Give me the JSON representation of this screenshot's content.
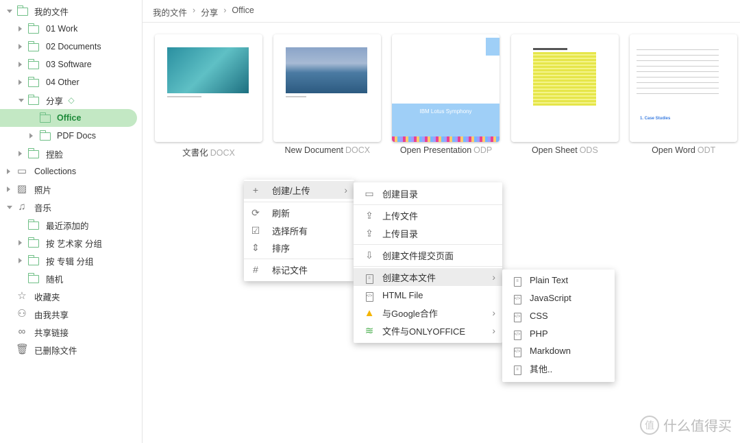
{
  "sidebar": {
    "items": [
      {
        "label": "我的文件",
        "level": 0,
        "expander": "expanded",
        "icon": "folder-icon"
      },
      {
        "label": "01 Work",
        "level": 1,
        "expander": "collapsed",
        "icon": "folder-icon"
      },
      {
        "label": "02 Documents",
        "level": 1,
        "expander": "collapsed",
        "icon": "folder-icon"
      },
      {
        "label": "03 Software",
        "level": 1,
        "expander": "collapsed",
        "icon": "folder-icon"
      },
      {
        "label": "04 Other",
        "level": 1,
        "expander": "collapsed",
        "icon": "folder-icon"
      },
      {
        "label": "分享",
        "level": 1,
        "expander": "expanded",
        "icon": "folder-icon",
        "tag": "tag-icon"
      },
      {
        "label": "Office",
        "level": 2,
        "expander": "none",
        "icon": "folder-icon",
        "active": true
      },
      {
        "label": "PDF Docs",
        "level": 2,
        "expander": "collapsed",
        "icon": "folder-icon"
      },
      {
        "label": "捏脸",
        "level": 1,
        "expander": "collapsed",
        "icon": "folder-icon"
      },
      {
        "label": "Collections",
        "level": 0,
        "expander": "collapsed",
        "icon": "archive-icon"
      },
      {
        "label": "照片",
        "level": 0,
        "expander": "collapsed",
        "icon": "image-icon"
      },
      {
        "label": "音乐",
        "level": 0,
        "expander": "expanded",
        "icon": "music-icon"
      },
      {
        "label": "最近添加的",
        "level": 1,
        "expander": "none",
        "icon": "folder-icon"
      },
      {
        "label": "按 艺术家 分组",
        "level": 1,
        "expander": "collapsed",
        "icon": "folder-icon"
      },
      {
        "label": "按 专辑 分组",
        "level": 1,
        "expander": "collapsed",
        "icon": "folder-icon"
      },
      {
        "label": "随机",
        "level": 1,
        "expander": "none",
        "icon": "folder-icon"
      },
      {
        "label": "收藏夹",
        "level": 0,
        "expander": "none",
        "icon": "star-icon"
      },
      {
        "label": "由我共享",
        "level": 0,
        "expander": "none",
        "icon": "user-plus-icon"
      },
      {
        "label": "共享链接",
        "level": 0,
        "expander": "none",
        "icon": "link-icon"
      },
      {
        "label": "已删除文件",
        "level": 0,
        "expander": "none",
        "icon": "trash-icon"
      }
    ]
  },
  "breadcrumb": [
    "我的文件",
    "分享",
    "Office"
  ],
  "files": [
    {
      "name": "文書化",
      "ext": "DOCX"
    },
    {
      "name": "New Document",
      "ext": "DOCX"
    },
    {
      "name": "Open Presentation",
      "ext": "ODP",
      "thumb_text": "IBM Lotus Symphony"
    },
    {
      "name": "Open Sheet",
      "ext": "ODS"
    },
    {
      "name": "Open Word",
      "ext": "ODT",
      "thumb_text": "1. Case Studies"
    }
  ],
  "context_menu": {
    "items": [
      {
        "label": "创建/上传",
        "icon": "plus-icon",
        "submenu": true
      },
      {
        "label": "刷新",
        "icon": "refresh-icon"
      },
      {
        "label": "选择所有",
        "icon": "checkbox-icon"
      },
      {
        "label": "排序",
        "icon": "sort-icon"
      },
      {
        "label": "标记文件",
        "icon": "hash-icon"
      }
    ]
  },
  "create_menu": {
    "items": [
      {
        "label": "创建目录",
        "icon": "folder-icon"
      },
      {
        "label": "上传文件",
        "icon": "upload-icon"
      },
      {
        "label": "上传目录",
        "icon": "upload-icon"
      },
      {
        "label": "创建文件提交页面",
        "icon": "inbox-download-icon"
      },
      {
        "label": "创建文本文件",
        "icon": "text-file-icon",
        "submenu": true
      },
      {
        "label": "HTML File",
        "icon": "code-file-icon"
      },
      {
        "label": "与Google合作",
        "icon": "google-drive-icon",
        "submenu": true
      },
      {
        "label": "文件与ONLYOFFICE",
        "icon": "onlyoffice-icon",
        "submenu": true
      }
    ]
  },
  "text_menu": {
    "items": [
      {
        "label": "Plain Text",
        "icon": "text-file-icon"
      },
      {
        "label": "JavaScript",
        "icon": "code-file-icon"
      },
      {
        "label": "CSS",
        "icon": "code-file-icon"
      },
      {
        "label": "PHP",
        "icon": "code-file-icon"
      },
      {
        "label": "Markdown",
        "icon": "code-file-icon"
      },
      {
        "label": "其他..",
        "icon": "text-file-icon"
      }
    ]
  },
  "watermark": "什么值得买",
  "colors": {
    "accent": "#1e8a3a",
    "active_bg": "#c3e8c4",
    "folder": "#6fbf86"
  }
}
